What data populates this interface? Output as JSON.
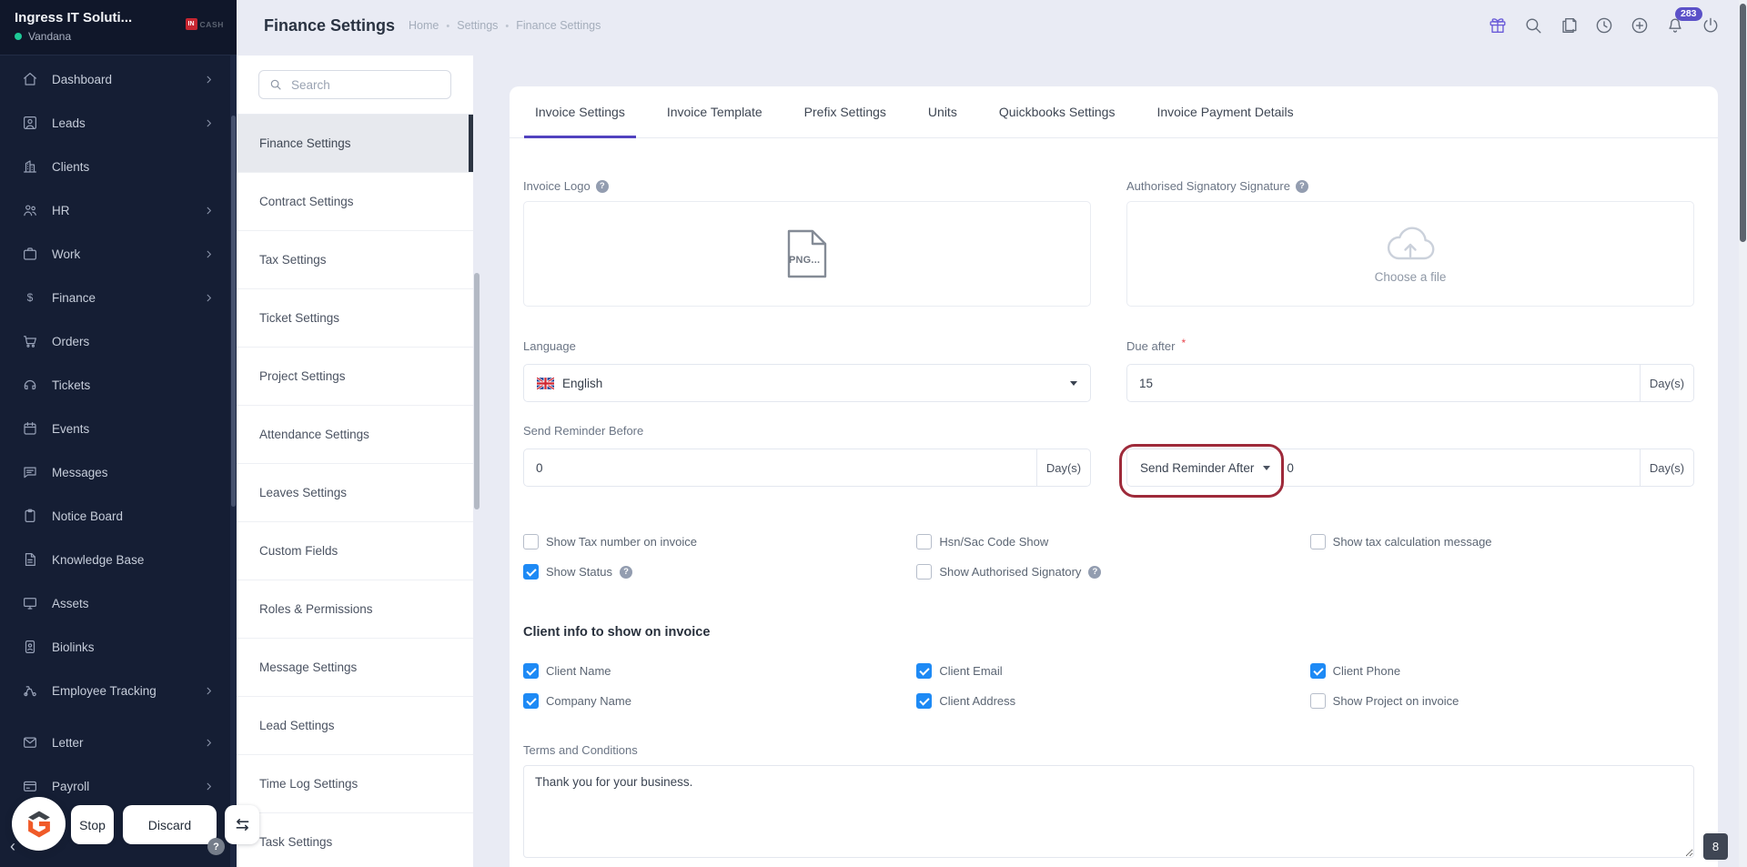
{
  "brand": {
    "company_name": "Ingress IT Soluti...",
    "user_name": "Vandana",
    "logo_badge": "IN",
    "logo_text": "CASH"
  },
  "sidebar": {
    "items": [
      {
        "label": "Dashboard",
        "icon": "home-icon",
        "chevron": true
      },
      {
        "label": "Leads",
        "icon": "lead-icon",
        "chevron": true
      },
      {
        "label": "Clients",
        "icon": "clients-icon",
        "chevron": false
      },
      {
        "label": "HR",
        "icon": "hr-icon",
        "chevron": true
      },
      {
        "label": "Work",
        "icon": "work-icon",
        "chevron": true
      },
      {
        "label": "Finance",
        "icon": "finance-icon",
        "chevron": true
      },
      {
        "label": "Orders",
        "icon": "orders-icon",
        "chevron": false
      },
      {
        "label": "Tickets",
        "icon": "tickets-icon",
        "chevron": false
      },
      {
        "label": "Events",
        "icon": "events-icon",
        "chevron": false
      },
      {
        "label": "Messages",
        "icon": "messages-icon",
        "chevron": false
      },
      {
        "label": "Notice Board",
        "icon": "notice-board-icon",
        "chevron": false
      },
      {
        "label": "Knowledge Base",
        "icon": "knowledge-base-icon",
        "chevron": false
      },
      {
        "label": "Assets",
        "icon": "assets-icon",
        "chevron": false
      },
      {
        "label": "Biolinks",
        "icon": "biolinks-icon",
        "chevron": false
      },
      {
        "label": "Employee Tracking",
        "icon": "employee-tracking-icon",
        "chevron": true
      },
      {
        "label": "Letter",
        "icon": "letter-icon",
        "chevron": true,
        "gap": true
      },
      {
        "label": "Payroll",
        "icon": "payroll-icon",
        "chevron": true
      }
    ]
  },
  "topbar": {
    "title": "Finance Settings",
    "breadcrumb": [
      "Home",
      "Settings",
      "Finance Settings"
    ],
    "icons": [
      {
        "name": "gift-icon"
      },
      {
        "name": "search-icon"
      },
      {
        "name": "notes-icon"
      },
      {
        "name": "history-icon"
      },
      {
        "name": "add-icon"
      },
      {
        "name": "notifications-icon",
        "badge": "283"
      },
      {
        "name": "logout-icon"
      }
    ]
  },
  "settings_nav": {
    "search_placeholder": "Search",
    "active_index": 0,
    "items": [
      "Finance Settings",
      "Contract Settings",
      "Tax Settings",
      "Ticket Settings",
      "Project Settings",
      "Attendance Settings",
      "Leaves Settings",
      "Custom Fields",
      "Roles & Permissions",
      "Message Settings",
      "Lead Settings",
      "Time Log Settings",
      "Task Settings"
    ]
  },
  "tabs": {
    "active_index": 0,
    "items": [
      "Invoice Settings",
      "Invoice Template",
      "Prefix Settings",
      "Units",
      "Quickbooks Settings",
      "Invoice Payment Details"
    ]
  },
  "form": {
    "invoice_logo_label": "Invoice Logo",
    "invoice_logo_file": "PNG...",
    "signature_label": "Authorised Signatory Signature",
    "signature_placeholder": "Choose a file",
    "language_label": "Language",
    "language_value": "English",
    "due_after_label": "Due after",
    "due_after_value": "15",
    "due_after_unit": "Day(s)",
    "reminder_before_label": "Send Reminder Before",
    "reminder_before_value": "0",
    "reminder_before_unit": "Day(s)",
    "reminder_after_button": "Send Reminder After",
    "reminder_after_value": "0",
    "reminder_after_unit": "Day(s)",
    "invoice_options": [
      {
        "label": "Show Tax number on invoice",
        "checked": false,
        "help": false
      },
      {
        "label": "Hsn/Sac Code Show",
        "checked": false,
        "help": false
      },
      {
        "label": "Show tax calculation message",
        "checked": false,
        "help": false
      },
      {
        "label": "Show Status",
        "checked": true,
        "help": true
      },
      {
        "label": "Show Authorised Signatory",
        "checked": false,
        "help": true
      }
    ],
    "client_info_heading": "Client info to show on invoice",
    "client_info_options": [
      {
        "label": "Client Name",
        "checked": true,
        "help": false
      },
      {
        "label": "Client Email",
        "checked": true,
        "help": false
      },
      {
        "label": "Client Phone",
        "checked": true,
        "help": false
      },
      {
        "label": "Company Name",
        "checked": true,
        "help": false
      },
      {
        "label": "Client Address",
        "checked": true,
        "help": false
      },
      {
        "label": "Show Project on invoice",
        "checked": false,
        "help": false
      }
    ],
    "terms_label": "Terms and Conditions",
    "terms_value": "Thank you for your business."
  },
  "floating": {
    "stop_label": "Stop",
    "discard_label": "Discard"
  },
  "page": {
    "count_badge": "8"
  },
  "colors": {
    "accent_purple": "#5142bf",
    "badge_purple": "#5b51c8",
    "checkbox_blue": "#1e8af5",
    "annotation_red": "#9e2a3a",
    "success_green": "#1ec997",
    "sidebar_dark": "#151e34"
  }
}
